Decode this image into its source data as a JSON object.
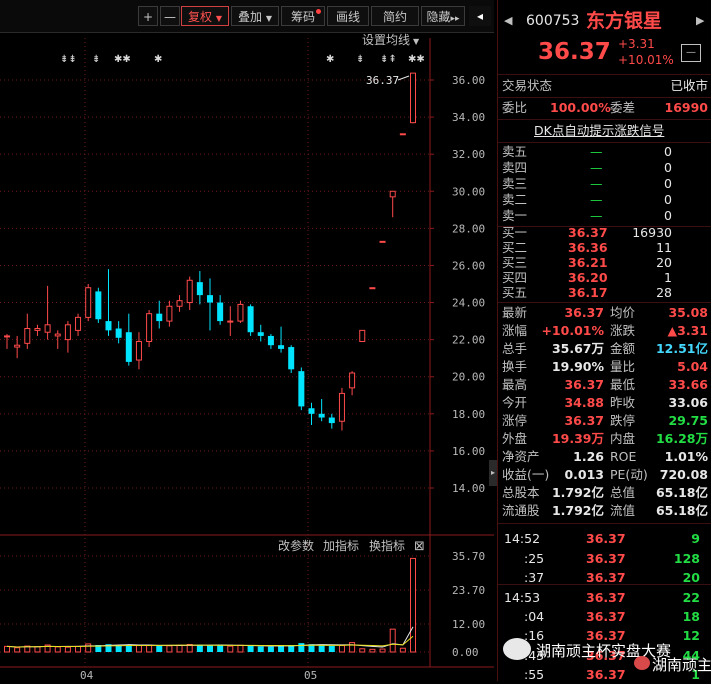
{
  "toolbar": {
    "plus": "+",
    "minus": "—",
    "fuquan": "复权",
    "diejia": "叠加",
    "chouma": "筹码",
    "huaxian": "画线",
    "jianyue": "简约",
    "yincang": "隐藏",
    "arrows": "▸▸",
    "panel_toggle": "◂"
  },
  "chart": {
    "ma_setting": "设置均线",
    "peak_label": "36.37",
    "signal_marks": [
      "⇟⇟",
      "⇟",
      "✱✱",
      "✱",
      "✱",
      "⇟",
      "⇟⇞",
      "✱✱"
    ],
    "price_ticks": [
      "36.00",
      "34.00",
      "32.00",
      "30.00",
      "28.00",
      "26.00",
      "24.00",
      "22.00",
      "20.00",
      "18.00",
      "16.00",
      "14.00"
    ],
    "volume_ticks": [
      "35.70",
      "23.70",
      "12.00",
      "0.00"
    ],
    "date_labels": [
      "04",
      "05"
    ],
    "indicator_buttons": [
      "改参数",
      "加指标",
      "换指标"
    ],
    "indicator_close": "⊠"
  },
  "chart_data": {
    "type": "candlestick",
    "ylim": [
      12.5,
      37.5
    ],
    "candles": [
      [
        22.2,
        22.2,
        21.5,
        22.3
      ],
      [
        21.6,
        21.7,
        21.0,
        22.2
      ],
      [
        21.8,
        22.6,
        21.5,
        23.4
      ],
      [
        22.5,
        22.6,
        22.2,
        22.8
      ],
      [
        22.4,
        22.8,
        22.0,
        24.9
      ],
      [
        22.2,
        22.3,
        21.5,
        22.5
      ],
      [
        22.0,
        22.8,
        21.3,
        23.0
      ],
      [
        22.5,
        23.2,
        22.2,
        23.4
      ],
      [
        23.2,
        24.8,
        23.0,
        25.0
      ],
      [
        24.6,
        23.1,
        22.9,
        24.8
      ],
      [
        23.0,
        22.5,
        22.2,
        25.8
      ],
      [
        22.6,
        22.1,
        21.8,
        23.0
      ],
      [
        22.4,
        20.8,
        20.6,
        23.4
      ],
      [
        20.9,
        21.9,
        20.4,
        22.4
      ],
      [
        21.9,
        23.4,
        21.6,
        23.6
      ],
      [
        23.4,
        23.0,
        22.6,
        24.1
      ],
      [
        23.0,
        23.8,
        22.7,
        24.1
      ],
      [
        23.8,
        24.1,
        23.5,
        24.4
      ],
      [
        24.0,
        25.2,
        23.6,
        25.4
      ],
      [
        25.1,
        24.4,
        23.9,
        25.7
      ],
      [
        24.4,
        24.0,
        22.5,
        25.3
      ],
      [
        24.0,
        23.0,
        22.8,
        24.4
      ],
      [
        23.0,
        23.0,
        22.2,
        23.8
      ],
      [
        23.0,
        23.9,
        22.9,
        24.1
      ],
      [
        23.8,
        22.4,
        22.2,
        23.9
      ],
      [
        22.4,
        22.2,
        21.9,
        22.8
      ],
      [
        22.2,
        21.7,
        21.5,
        22.3
      ],
      [
        21.7,
        21.5,
        21.3,
        22.7
      ],
      [
        21.6,
        20.4,
        20.2,
        21.7
      ],
      [
        20.3,
        18.4,
        18.2,
        20.5
      ],
      [
        18.3,
        18.0,
        17.4,
        18.6
      ],
      [
        18.0,
        17.8,
        17.6,
        18.8
      ],
      [
        17.8,
        17.5,
        17.2,
        18.0
      ],
      [
        17.6,
        19.1,
        17.1,
        19.4
      ],
      [
        19.4,
        20.2,
        19.0,
        20.3
      ],
      [
        21.9,
        22.5,
        21.9,
        22.5
      ],
      [
        24.8,
        24.8,
        24.8,
        24.8
      ],
      [
        27.3,
        27.3,
        27.3,
        27.3
      ],
      [
        29.7,
        30.0,
        28.6,
        30.0
      ],
      [
        33.1,
        33.1,
        33.1,
        33.1
      ],
      [
        33.7,
        36.37,
        33.66,
        36.37
      ]
    ],
    "volumes": [
      2.1,
      1.6,
      2.2,
      2.0,
      2.6,
      1.9,
      1.8,
      2.1,
      3.0,
      2.6,
      2.9,
      2.3,
      2.8,
      2.4,
      2.5,
      2.3,
      2.3,
      2.5,
      2.8,
      2.7,
      2.4,
      2.6,
      2.2,
      2.5,
      2.3,
      2.1,
      2.0,
      2.4,
      2.6,
      3.3,
      2.9,
      2.4,
      2.3,
      2.4,
      3.5,
      1.2,
      1.0,
      1.1,
      8.5,
      1.4,
      34.8
    ]
  },
  "quote": {
    "code": "600753",
    "name": "东方银星",
    "price": "36.37",
    "change": "+3.31",
    "change_pct": "+10.01%",
    "btn": "—",
    "status_label": "交易状态",
    "status_value": "已收市",
    "weibi_label": "委比",
    "weibi_value": "100.00%",
    "weicha_label": "委差",
    "weicha_value": "16990",
    "dk_title": "DK点自动提示涨跌信号"
  },
  "order_book": {
    "asks": [
      {
        "label": "卖五",
        "price": "—",
        "vol": "0"
      },
      {
        "label": "卖四",
        "price": "—",
        "vol": "0"
      },
      {
        "label": "卖三",
        "price": "—",
        "vol": "0"
      },
      {
        "label": "卖二",
        "price": "—",
        "vol": "0"
      },
      {
        "label": "卖一",
        "price": "—",
        "vol": "0"
      }
    ],
    "bids": [
      {
        "label": "买一",
        "price": "36.37",
        "vol": "16930"
      },
      {
        "label": "买二",
        "price": "36.36",
        "vol": "11"
      },
      {
        "label": "买三",
        "price": "36.21",
        "vol": "20"
      },
      {
        "label": "买四",
        "price": "36.20",
        "vol": "1"
      },
      {
        "label": "买五",
        "price": "36.17",
        "vol": "28"
      }
    ]
  },
  "stats": [
    {
      "l1": "最新",
      "v1": "36.37",
      "c1": "red",
      "l2": "均价",
      "v2": "35.08",
      "c2": "red"
    },
    {
      "l1": "涨幅",
      "v1": "+10.01%",
      "c1": "red",
      "l2": "涨跌",
      "v2": "▲3.31",
      "c2": "red"
    },
    {
      "l1": "总手",
      "v1": "35.67万",
      "c1": "white",
      "l2": "金额",
      "v2": "12.51亿",
      "c2": "cyan"
    },
    {
      "l1": "换手",
      "v1": "19.90%",
      "c1": "white",
      "l2": "量比",
      "v2": "5.04",
      "c2": "red"
    },
    {
      "l1": "最高",
      "v1": "36.37",
      "c1": "red",
      "l2": "最低",
      "v2": "33.66",
      "c2": "red"
    },
    {
      "l1": "今开",
      "v1": "34.88",
      "c1": "red",
      "l2": "昨收",
      "v2": "33.06",
      "c2": "white"
    },
    {
      "l1": "涨停",
      "v1": "36.37",
      "c1": "red",
      "l2": "跌停",
      "v2": "29.75",
      "c2": "green"
    },
    {
      "l1": "外盘",
      "v1": "19.39万",
      "c1": "red",
      "l2": "内盘",
      "v2": "16.28万",
      "c2": "green"
    },
    {
      "l1": "净资产",
      "v1": "1.26",
      "c1": "white",
      "l2": "ROE",
      "v2": "1.01%",
      "c2": "white"
    },
    {
      "l1": "收益(一)",
      "v1": "0.013",
      "c1": "white",
      "l2": "PE(动)",
      "v2": "720.08",
      "c2": "white"
    },
    {
      "l1": "总股本",
      "v1": "1.792亿",
      "c1": "white",
      "l2": "总值",
      "v2": "65.18亿",
      "c2": "white"
    },
    {
      "l1": "流通股",
      "v1": "1.792亿",
      "c1": "white",
      "l2": "流值",
      "v2": "65.18亿",
      "c2": "white"
    }
  ],
  "ticks": [
    {
      "time": "14:52",
      "price": "36.37",
      "vol": "9",
      "vc": "green"
    },
    {
      "time": ":25",
      "price": "36.37",
      "vol": "128",
      "vc": "green"
    },
    {
      "time": ":37",
      "price": "36.37",
      "vol": "20",
      "vc": "green"
    },
    {
      "time": "14:53",
      "price": "36.37",
      "vol": "22",
      "vc": "green"
    },
    {
      "time": ":04",
      "price": "36.37",
      "vol": "18",
      "vc": "green"
    },
    {
      "time": ":16",
      "price": "36.37",
      "vol": "12",
      "vc": "green"
    },
    {
      "time": ":43",
      "price": "36.37",
      "vol": "44",
      "vc": "green"
    },
    {
      "time": ":55",
      "price": "36.37",
      "vol": "1",
      "vc": "green"
    }
  ],
  "watermark": {
    "left": "湖南顽主杯实盘大赛",
    "right": "湖南顽主"
  },
  "colors": {
    "up": "#ff4a4a",
    "down": "#00e5ff",
    "grid": "#6a1a1a",
    "bg": "#000000"
  }
}
